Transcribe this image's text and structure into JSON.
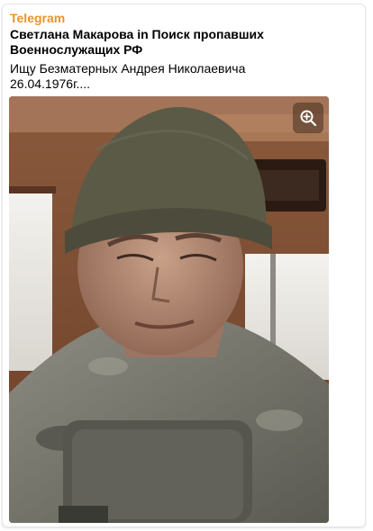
{
  "post": {
    "source": "Telegram",
    "title": "Светлана Макарова in Поиск пропавших Военнослужащих РФ",
    "text": "Ищу Безматерных Андрея  Николаевича\n26.04.1976г...."
  },
  "photo": {
    "zoom_icon": "zoom-in-icon"
  }
}
